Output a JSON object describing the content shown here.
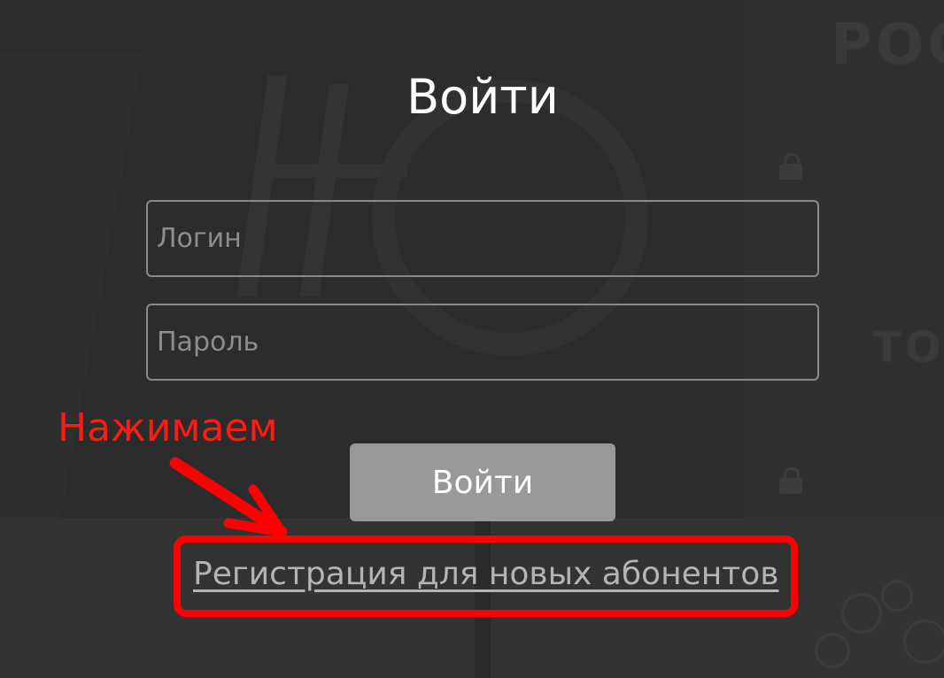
{
  "login": {
    "title": "Войти",
    "login_placeholder": "Логин",
    "password_placeholder": "Пароль",
    "submit_label": "Войти",
    "register_link": "Регистрация для новых абонентов"
  },
  "annotation": {
    "label": "Нажимаем",
    "color": "#ff0000"
  },
  "background": {
    "text_top": "РОС",
    "text_middle": "ТО"
  },
  "colors": {
    "background": "#2c2c2d",
    "button": "#999999",
    "field_border": "#8a8a8a",
    "link": "#b4b4b4"
  }
}
